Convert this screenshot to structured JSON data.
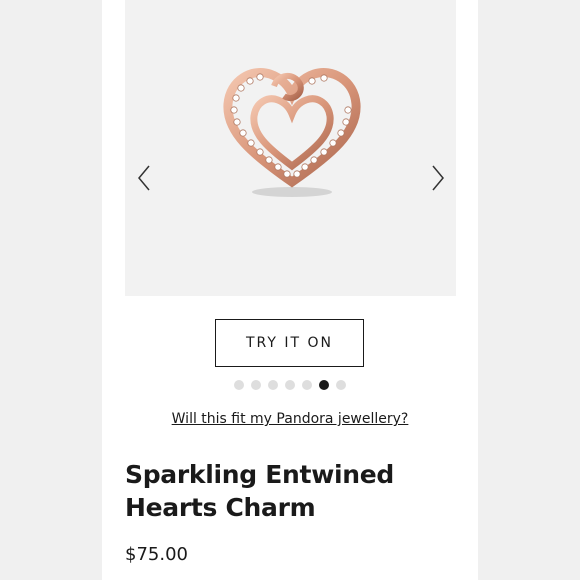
{
  "gallery": {
    "image_icon": "rose-gold-entwined-hearts-charm",
    "prev_icon": "chevron-left-icon",
    "next_icon": "chevron-right-icon",
    "slide_count": 7,
    "active_slide": 6
  },
  "try_on": {
    "label": "TRY IT ON"
  },
  "fit_link": {
    "label": "Will this fit my Pandora jewellery?"
  },
  "product": {
    "title_line1": "Sparkling Entwined",
    "title_line2": "Hearts Charm",
    "price": "$75.00"
  },
  "colors": {
    "accent": "#1a1a1a",
    "gallery_bg": "#f2f2f2",
    "rose_gold": "#d9967a",
    "dot_inactive": "#dedede"
  }
}
